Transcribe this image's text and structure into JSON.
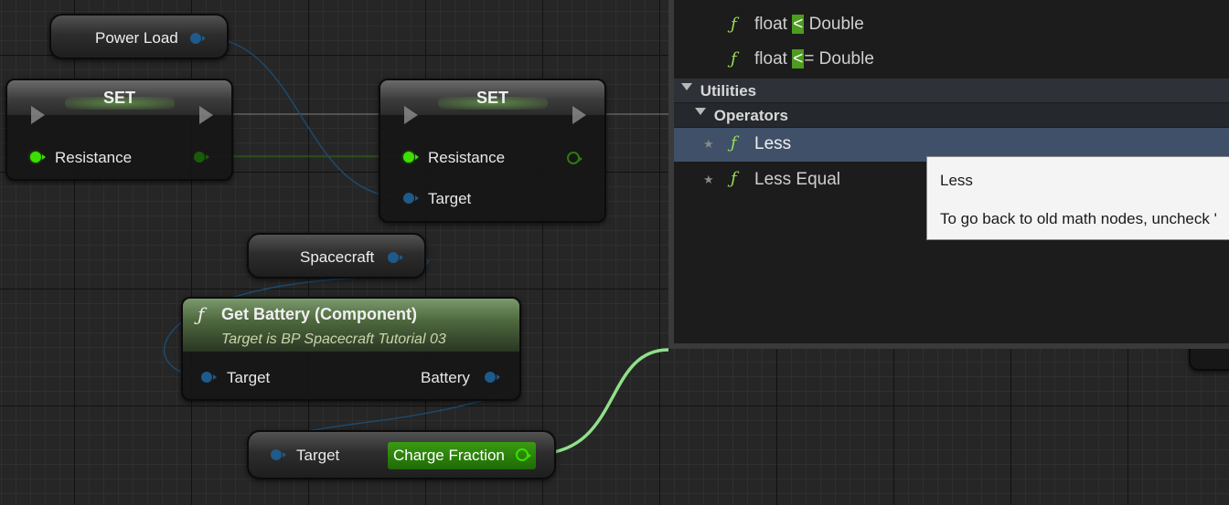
{
  "graph": {
    "power_load_label": "Power Load",
    "set_node_1": {
      "title": "SET",
      "pin_label": "Resistance"
    },
    "set_node_2": {
      "title": "SET",
      "pin_label": "Resistance",
      "target_label": "Target"
    },
    "spacecraft_label": "Spacecraft",
    "get_battery": {
      "title": "Get Battery (Component)",
      "subtitle": "Target is BP Spacecraft Tutorial 03",
      "input_label": "Target",
      "output_label": "Battery"
    },
    "charge_node": {
      "input_label": "Target",
      "output_label": "Charge Fraction"
    },
    "colors": {
      "exec": "#8e8e8e",
      "float_pin": "#3be000",
      "object_pin": "#1e5a8a",
      "wire_float": "#8fe08a",
      "wire_object": "#1c4a6e"
    }
  },
  "action_menu": {
    "items_top": [
      {
        "icon": "function-icon",
        "prefix": "float ",
        "match": "<",
        "suffix": " Double"
      },
      {
        "icon": "function-icon",
        "prefix": "float ",
        "match": "<",
        "suffix": "= Double"
      }
    ],
    "category": "Utilities",
    "subcategory": "Operators",
    "items": [
      {
        "icon": "function-icon",
        "label": "Less",
        "selected": true
      },
      {
        "icon": "function-icon",
        "label": "Less Equal",
        "selected": false
      }
    ]
  },
  "tooltip": {
    "title": "Less",
    "body": "To go back to old math nodes, uncheck '"
  }
}
